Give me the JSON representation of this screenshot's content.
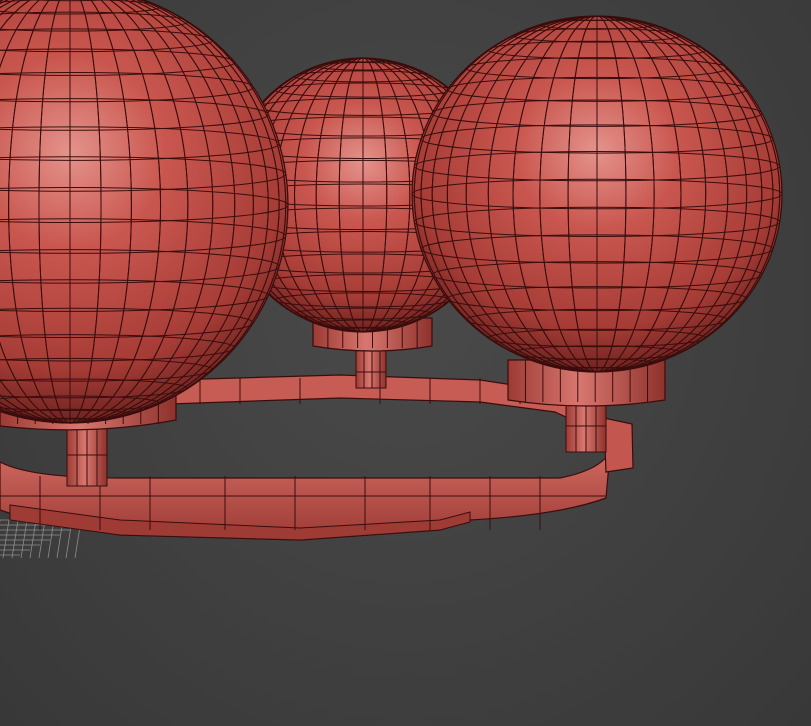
{
  "viewport": {
    "background_color": "#3e3e3e",
    "grid_color": "#8f8f8f",
    "wireframe_color": "#3a0d0d"
  },
  "model": {
    "material_color": "#c04a44",
    "highlight_color": "#e4938c",
    "shadow_color": "#6e2320",
    "objects": [
      "sphere-left",
      "sphere-back",
      "sphere-right",
      "sphere-collar-left",
      "sphere-collar-back",
      "sphere-collar-right",
      "stem-left",
      "stem-back",
      "stem-right",
      "ring-frame"
    ]
  }
}
